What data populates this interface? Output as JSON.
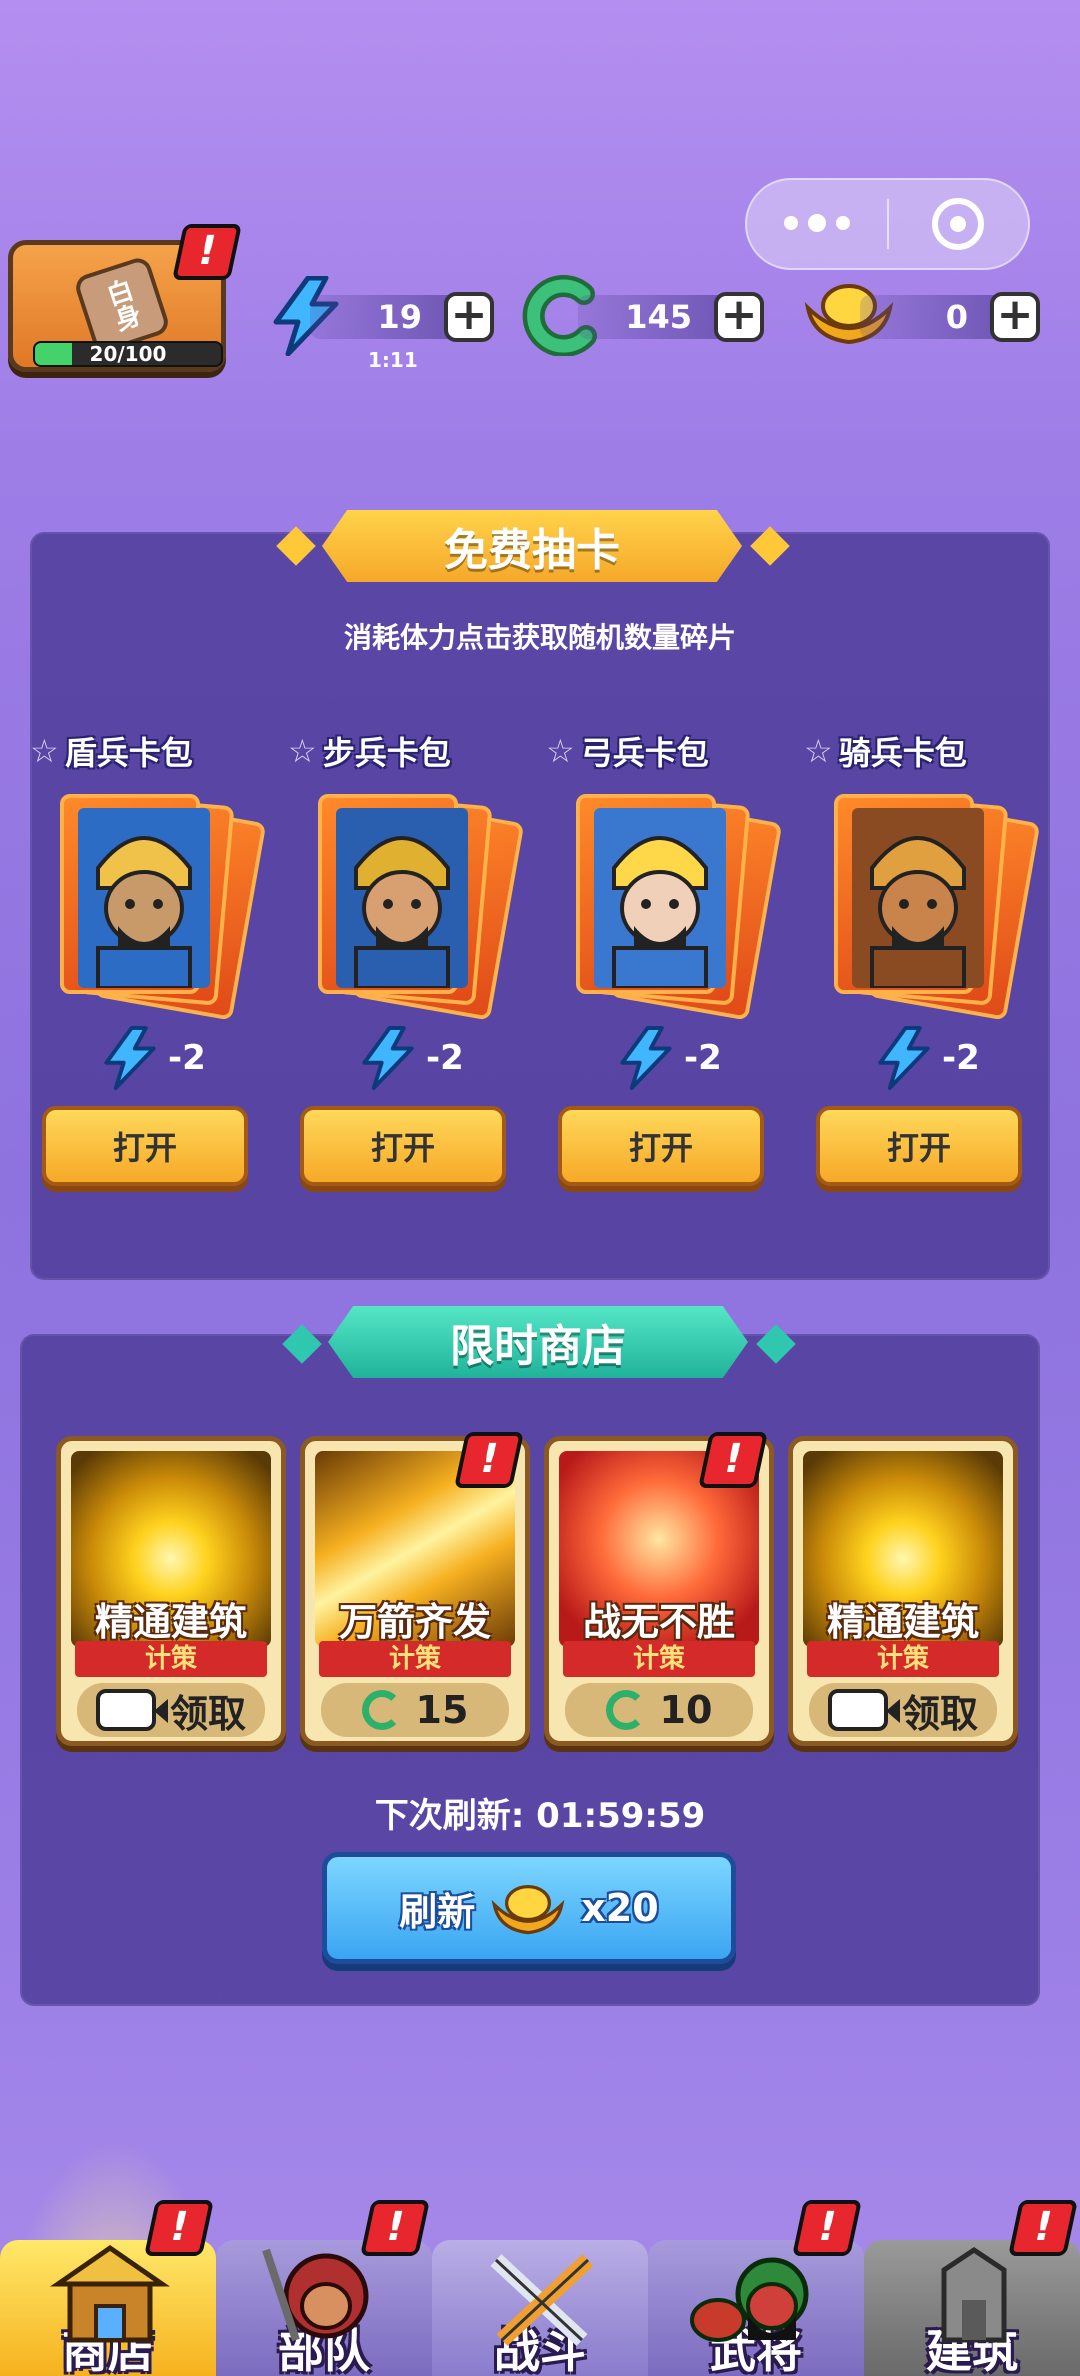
{
  "header": {
    "avatar_tag": "白身",
    "xp_text": "20/100",
    "xp_progress": 0.2,
    "alert_mark": "!",
    "energy": {
      "value": "19",
      "timer": "1:11"
    },
    "jade": {
      "value": "145"
    },
    "gold": {
      "value": "0"
    },
    "plus": "+"
  },
  "free_draw": {
    "title": "免费抽卡",
    "subtitle": "消耗体力点击获取随机数量碎片",
    "packs": [
      {
        "name": "盾兵卡包",
        "cost": "-2",
        "button": "打开"
      },
      {
        "name": "步兵卡包",
        "cost": "-2",
        "button": "打开"
      },
      {
        "name": "弓兵卡包",
        "cost": "-2",
        "button": "打开"
      },
      {
        "name": "骑兵卡包",
        "cost": "-2",
        "button": "打开"
      }
    ]
  },
  "limited_shop": {
    "title": "限时商店",
    "items": [
      {
        "name": "精通建筑",
        "type": "计策",
        "price": "领取",
        "price_kind": "video",
        "alert": false
      },
      {
        "name": "万箭齐发",
        "type": "计策",
        "price": "15",
        "price_kind": "jade",
        "alert": true
      },
      {
        "name": "战无不胜",
        "type": "计策",
        "price": "10",
        "price_kind": "jade",
        "alert": true
      },
      {
        "name": "精通建筑",
        "type": "计策",
        "price": "领取",
        "price_kind": "video",
        "alert": false
      }
    ],
    "next_refresh_label": "下次刷新:",
    "next_refresh_time": "01:59:59",
    "refresh_button": "刷新",
    "refresh_cost": "x20"
  },
  "nav": {
    "tabs": [
      {
        "label": "商店",
        "active": true,
        "alert": true
      },
      {
        "label": "部队",
        "active": false,
        "alert": true
      },
      {
        "label": "战斗",
        "active": false,
        "alert": false
      },
      {
        "label": "武将",
        "active": false,
        "alert": true
      },
      {
        "label": "建筑",
        "active": false,
        "alert": true,
        "locked": true
      }
    ]
  },
  "colors": {
    "bg": "#9d7de6",
    "panel": "#4c3a96",
    "gold_button": "#f7a928",
    "teal_banner": "#1fb39a",
    "alert": "#e8262e",
    "refresh_button": "#3aa5f2"
  }
}
